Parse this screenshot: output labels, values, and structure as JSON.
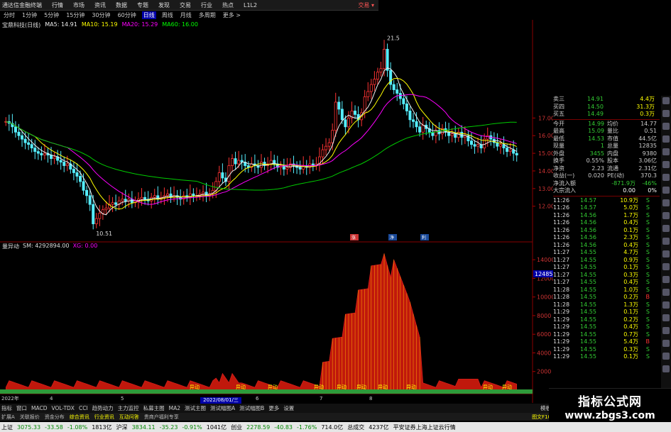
{
  "titlebar": {
    "items": [
      "通达信金融终端",
      "行情",
      "市场",
      "资讯",
      "数据",
      "专题",
      "发现",
      "交易",
      "行业",
      "热点",
      "L1L2"
    ],
    "trade": "交易 ▾"
  },
  "periods": {
    "items": [
      "分时",
      "1分钟",
      "5分钟",
      "15分钟",
      "30分钟",
      "60分钟",
      "日线",
      "周线",
      "月线",
      "多周期",
      "更多 >"
    ],
    "active_index": 6
  },
  "ma_bar": {
    "stock": "宝鼎科技(日线)",
    "ma5": "MA5: 14.91",
    "ma10": "MA10: 15.19",
    "ma20": "MA20: 15.29",
    "ma60": "MA60: 16.00"
  },
  "price_chart": {
    "high_label": "21.5",
    "low_label": "10.51",
    "y_ticks": [
      "17.00",
      "16.00",
      "15.00",
      "14.00",
      "13.00",
      "12.00"
    ],
    "markers": [
      "涨",
      "净",
      "利"
    ]
  },
  "volume_chart": {
    "label_name": "量异动",
    "label_sm": "SM: 4292894.00",
    "label_xg": "XG: 0.00",
    "y_ticks": [
      "14000",
      "12000",
      "10000",
      "8000",
      "6000",
      "4000",
      "2000"
    ],
    "current": "12485",
    "signal_text": "异动"
  },
  "axis": {
    "year": "2022年",
    "month_marks": [
      "4",
      "5",
      "6",
      "7",
      "8"
    ],
    "selected_date": "2022/08/01/三"
  },
  "quote": {
    "sell_rows": [
      {
        "label": "卖三",
        "price": "14.91",
        "vol": "4.4万"
      },
      {
        "label": "买四",
        "price": "14.50",
        "vol": "31.3万"
      },
      {
        "label": "买五",
        "price": "14.49",
        "vol": "0.3万"
      }
    ],
    "stats": [
      {
        "l1": "今开",
        "v1": "14.99",
        "l2": "均价",
        "v2": "14.77"
      },
      {
        "l1": "最高",
        "v1": "15.09",
        "l2": "量比",
        "v2": "0.51"
      },
      {
        "l1": "最低",
        "v1": "14.53",
        "l2": "市值",
        "v2": "44.5亿"
      },
      {
        "l1": "现量",
        "v1": "1",
        "l2": "总量",
        "v2": "12835"
      },
      {
        "l1": "外盘",
        "v1": "3455",
        "l2": "内盘",
        "v2": "9380"
      },
      {
        "l1": "换手",
        "v1": "0.55%",
        "l2": "股本",
        "v2": "3.06亿"
      },
      {
        "l1": "净资",
        "v1": "2.23",
        "l2": "流通",
        "v2": "2.31亿"
      },
      {
        "l1": "收益(一)",
        "v1": "0.020",
        "l2": "PE(动)",
        "v2": "370.3"
      }
    ],
    "flow": [
      {
        "label": "净流入额",
        "value": "-871.9万",
        "pct": "-46%"
      },
      {
        "label": "大宗流入",
        "value": "0.00",
        "pct": "0%"
      }
    ]
  },
  "ticks": [
    {
      "t": "11:26",
      "p": "14.57",
      "v": "10.9万",
      "d": "S"
    },
    {
      "t": "11:26",
      "p": "14.57",
      "v": "5.0万",
      "d": "S"
    },
    {
      "t": "11:26",
      "p": "14.56",
      "v": "1.7万",
      "d": "S"
    },
    {
      "t": "11:26",
      "p": "14.56",
      "v": "0.4万",
      "d": "S"
    },
    {
      "t": "11:26",
      "p": "14.56",
      "v": "0.1万",
      "d": "S"
    },
    {
      "t": "11:26",
      "p": "14.56",
      "v": "2.3万",
      "d": "S"
    },
    {
      "t": "11:26",
      "p": "14.56",
      "v": "0.4万",
      "d": "S"
    },
    {
      "t": "11:27",
      "p": "14.55",
      "v": "4.7万",
      "d": "S"
    },
    {
      "t": "11:27",
      "p": "14.55",
      "v": "0.9万",
      "d": "S"
    },
    {
      "t": "11:27",
      "p": "14.55",
      "v": "0.1万",
      "d": "S"
    },
    {
      "t": "11:27",
      "p": "14.55",
      "v": "0.3万",
      "d": "S"
    },
    {
      "t": "11:27",
      "p": "14.55",
      "v": "0.4万",
      "d": "S"
    },
    {
      "t": "11:28",
      "p": "14.55",
      "v": "1.0万",
      "d": "S"
    },
    {
      "t": "11:28",
      "p": "14.55",
      "v": "0.2万",
      "d": "B"
    },
    {
      "t": "11:28",
      "p": "14.55",
      "v": "1.3万",
      "d": "S"
    },
    {
      "t": "11:29",
      "p": "14.55",
      "v": "0.1万",
      "d": "S"
    },
    {
      "t": "11:29",
      "p": "14.55",
      "v": "0.2万",
      "d": "S"
    },
    {
      "t": "11:29",
      "p": "14.55",
      "v": "0.4万",
      "d": "S"
    },
    {
      "t": "11:29",
      "p": "14.55",
      "v": "0.7万",
      "d": "S"
    },
    {
      "t": "11:29",
      "p": "14.55",
      "v": "5.4万",
      "d": "B"
    },
    {
      "t": "11:29",
      "p": "14.55",
      "v": "0.3万",
      "d": "S"
    },
    {
      "t": "11:29",
      "p": "14.55",
      "v": "0.1万",
      "d": "S"
    }
  ],
  "tabs": [
    "指标",
    "窗口",
    "MACD",
    "VOL-TDX",
    "CCI",
    "趋势动力",
    "主力监控",
    "私募主图",
    "MA2",
    "测试主图",
    "测试幅图A",
    "测试幅图B",
    "更多",
    "设置"
  ],
  "tabs2": [
    "扩展A",
    "关联报价",
    "资金分布",
    "综合资讯",
    "行业资讯",
    "互动问答",
    "贵商户福利专享"
  ],
  "tabs2_right": "图文F10",
  "tabs_right": "模板",
  "status": {
    "sh_label": "上证",
    "sh": "3075.33",
    "sh_chg": "-33.58",
    "sh_pct": "-1.08%",
    "sh_amt": "1813亿",
    "hs_label": "沪深",
    "hs": "3834.11",
    "hs_chg": "-35.23",
    "hs_pct": "-0.91%",
    "hs_amt": "1041亿",
    "cy_label": "创业",
    "cy": "2278.59",
    "cy_chg": "-40.83",
    "cy_pct": "-1.76%",
    "cy_amt": "714.0亿",
    "total_label": "总成交",
    "total": "4237亿",
    "broker": "平安证券上海上证云行情"
  },
  "watermark": {
    "title": "指标公式网",
    "url": "www.zbgs3.com"
  },
  "chart_data": [
    {
      "type": "candlestick",
      "title": "宝鼎科技(日线)",
      "y_ticks": [
        12,
        13,
        14,
        15,
        16,
        17
      ],
      "annotations": {
        "high": 21.5,
        "low": 10.51
      },
      "close": [
        16.8,
        16.7,
        16.5,
        16.2,
        16.0,
        15.8,
        15.6,
        15.5,
        15.3,
        15.1,
        15.0,
        14.9,
        15.0,
        14.9,
        14.7,
        14.8,
        14.6,
        14.5,
        14.3,
        14.4,
        14.1,
        13.9,
        13.7,
        13.4,
        12.9,
        12.6,
        12.1,
        11.0,
        11.3,
        11.6,
        11.8,
        11.9,
        12.1,
        12.2,
        12.1,
        12.3,
        12.4,
        12.3,
        12.4,
        12.2,
        12.3,
        12.4,
        12.5,
        12.4,
        12.3,
        12.5,
        12.6,
        12.4,
        12.5,
        12.6,
        12.7,
        12.5,
        12.6,
        12.5,
        12.4,
        12.6,
        12.5,
        12.7,
        12.6,
        12.6,
        12.7,
        12.8,
        12.6,
        12.7,
        12.9,
        13.4,
        13.9,
        13.6,
        13.4,
        14.3,
        14.7,
        14.4,
        14.6,
        14.5,
        14.3,
        14.2,
        14.4,
        14.3,
        14.2,
        14.5,
        14.3,
        14.4,
        14.6,
        14.4,
        14.2,
        14.3,
        14.1,
        14.2,
        14.4,
        14.3,
        14.2,
        14.1,
        14.3,
        14.2,
        14.4,
        14.3,
        14.4,
        14.8,
        15.2,
        15.4,
        15.6,
        16.3,
        17.9,
        17.5,
        16.9,
        16.5,
        17.0,
        17.4,
        17.2,
        16.9,
        17.3,
        18.2,
        18.5,
        18.9,
        19.2,
        19.6,
        19.8,
        20.9,
        19.7,
        18.9,
        18.6,
        18.4,
        18.1,
        17.8,
        17.4,
        16.9,
        16.8,
        16.5,
        16.2,
        16.6,
        16.4,
        16.2,
        16.0,
        16.3,
        16.1,
        16.4,
        16.2,
        16.0,
        16.1,
        15.9,
        16.2,
        15.9,
        16.0,
        15.7,
        15.5,
        15.4,
        15.5,
        15.3,
        15.8,
        16.0,
        15.8,
        15.6,
        15.4,
        15.5,
        15.3,
        15.1,
        15.2,
        15.0,
        14.9
      ]
    },
    {
      "type": "bar",
      "title": "量异动",
      "y_ticks": [
        2000,
        4000,
        6000,
        8000,
        10000,
        12000,
        14000
      ],
      "current": 12485
    }
  ]
}
